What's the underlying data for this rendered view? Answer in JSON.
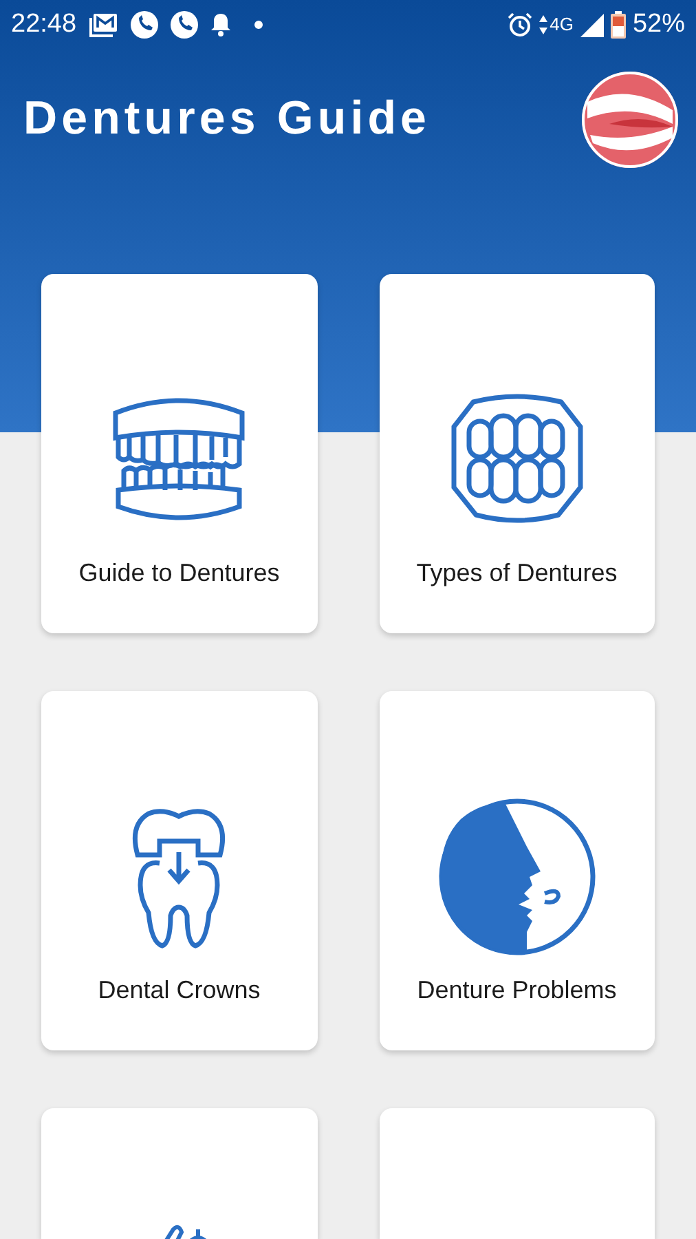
{
  "status_bar": {
    "time": "22:48",
    "network": "4G",
    "battery": "52%"
  },
  "app_bar": {
    "title": "Dentures Guide"
  },
  "cards": [
    {
      "kind": "dentures",
      "title": "Guide to Dentures"
    },
    {
      "kind": "teeth",
      "title": "Types of Dentures"
    },
    {
      "kind": "crown",
      "title": "Dental Crowns"
    },
    {
      "kind": "face",
      "title": "Denture Problems"
    },
    {
      "kind": "tools"
    },
    {
      "kind": "blank"
    }
  ]
}
